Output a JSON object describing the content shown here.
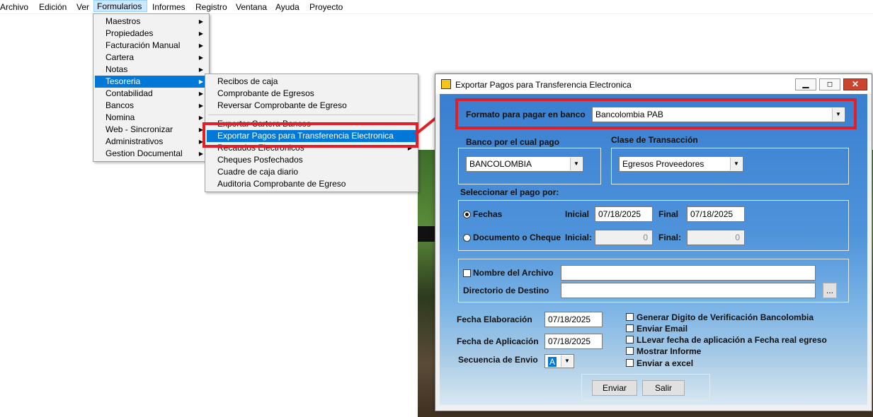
{
  "menubar": {
    "items": [
      "Archivo",
      "Edición",
      "Ver",
      "Formularios",
      "Informes",
      "Registro",
      "Ventana",
      "Ayuda",
      "Proyecto"
    ]
  },
  "formularios_menu": {
    "items": [
      {
        "label": "Maestros",
        "arrow": "▶"
      },
      {
        "label": "Propiedades",
        "arrow": "▶"
      },
      {
        "label": "Facturación Manual",
        "arrow": "▶"
      },
      {
        "label": "Cartera",
        "arrow": "▶"
      },
      {
        "label": "Notas",
        "arrow": "▶"
      },
      {
        "label": "Tesoreria",
        "arrow": "▶"
      },
      {
        "label": "Contabilidad",
        "arrow": "▶"
      },
      {
        "label": "Bancos",
        "arrow": "▶"
      },
      {
        "label": "Nomina",
        "arrow": "▶"
      },
      {
        "label": "Web - Sincronizar",
        "arrow": "▶"
      },
      {
        "label": "Administrativos",
        "arrow": "▶"
      },
      {
        "label": "Gestion Documental",
        "arrow": "▶"
      }
    ]
  },
  "tesoreria_menu": {
    "items": [
      {
        "label": "Recibos de caja"
      },
      {
        "label": "Comprobante de Egresos"
      },
      {
        "label": "Reversar Comprobante de Egreso"
      },
      {
        "label": "Exportar Cartera Bancos"
      },
      {
        "label": "Exportar Pagos para Transferencia Electronica"
      },
      {
        "label": "Recaudos Electronicos",
        "arrow": "▶"
      },
      {
        "label": "Cheques Posfechados"
      },
      {
        "label": "Cuadre de caja diario"
      },
      {
        "label": "Auditoria Comprobante de Egreso"
      }
    ]
  },
  "dialog": {
    "title": "Exportar Pagos para Transferencia Electronica",
    "formato_label": "Formato para pagar en banco",
    "formato_value": "Bancolombia PAB",
    "banco_label": "Banco por el cual pago",
    "banco_value": "BANCOLOMBIA",
    "clase_label": "Clase de Transacción",
    "clase_value": "Egresos Proveedores",
    "seleccionar_label": "Seleccionar el pago por:",
    "fechas_label": "Fechas",
    "documento_label": "Documento o Cheque",
    "inicial_label": "Inicial",
    "inicial_label2": "Inicial:",
    "final_label": "Final",
    "final_label2": "Final:",
    "fecha_inicial": "07/18/2025",
    "fecha_final": "07/18/2025",
    "doc_inicial": "0",
    "doc_final": "0",
    "nombre_archivo_label": "Nombre del Archivo",
    "directorio_label": "Directorio de Destino",
    "browse_label": "...",
    "fecha_elaboracion_label": "Fecha Elaboración",
    "fecha_elaboracion": "07/18/2025",
    "fecha_aplicacion_label": "Fecha de Aplicación",
    "fecha_aplicacion": "07/18/2025",
    "secuencia_label": "Secuencia de Envio",
    "secuencia_value": "A",
    "opt_digito": "Generar Digito de Verificación Bancolombia",
    "opt_email": "Enviar Email",
    "opt_llevar": "LLevar fecha de aplicación a Fecha real egreso",
    "opt_mostrar": "Mostrar Informe",
    "opt_excel": "Enviar a excel",
    "enviar_label": "Enviar",
    "salir_label": "Salir"
  },
  "colors": {
    "highlight": "#0078d7",
    "annotation": "#e41e26",
    "dialog_body": "#4e93da"
  },
  "icons": [
    "dialog-app-icon",
    "minimize-icon",
    "maximize-icon",
    "close-icon",
    "submenu-arrow-icon",
    "dropdown-arrow-icon"
  ]
}
